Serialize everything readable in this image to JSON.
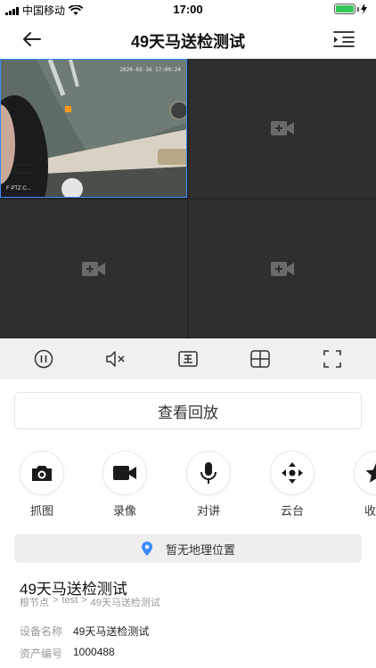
{
  "status_bar": {
    "carrier": "中国移动",
    "time": "17:00",
    "battery_level": 1.0,
    "battery_color": "#34c759"
  },
  "nav": {
    "title": "49天马送检测试",
    "back_icon": "arrow-left-icon",
    "menu_icon": "list-indent-icon"
  },
  "video": {
    "active_cell": {
      "timestamp": "2020-03-16 17:00:24",
      "camera_label": "F PTZ C..."
    },
    "empty_cell_icon": "video-add-icon",
    "active_border_color": "#3d8bff"
  },
  "toolbar": {
    "buttons": [
      "pause-icon",
      "mute-icon",
      "main-stream-icon",
      "grid-layout-icon",
      "fullscreen-icon"
    ]
  },
  "playback": {
    "label": "查看回放"
  },
  "actions": [
    {
      "label": "抓图",
      "icon": "camera-icon"
    },
    {
      "label": "录像",
      "icon": "video-record-icon"
    },
    {
      "label": "对讲",
      "icon": "microphone-icon"
    },
    {
      "label": "云台",
      "icon": "ptz-arrows-icon"
    },
    {
      "label": "收藏",
      "icon": "star-icon"
    }
  ],
  "location": {
    "text": "暂无地理位置",
    "icon_color": "#3d8bff"
  },
  "device": {
    "name": "49天马送检测试",
    "breadcrumb": [
      "根节点",
      ">",
      "test",
      ">",
      "49天马送检测试"
    ],
    "fields": [
      {
        "key": "设备名称",
        "value": "49天马送检测试"
      },
      {
        "key": "资产编号",
        "value": "1000488"
      }
    ]
  }
}
